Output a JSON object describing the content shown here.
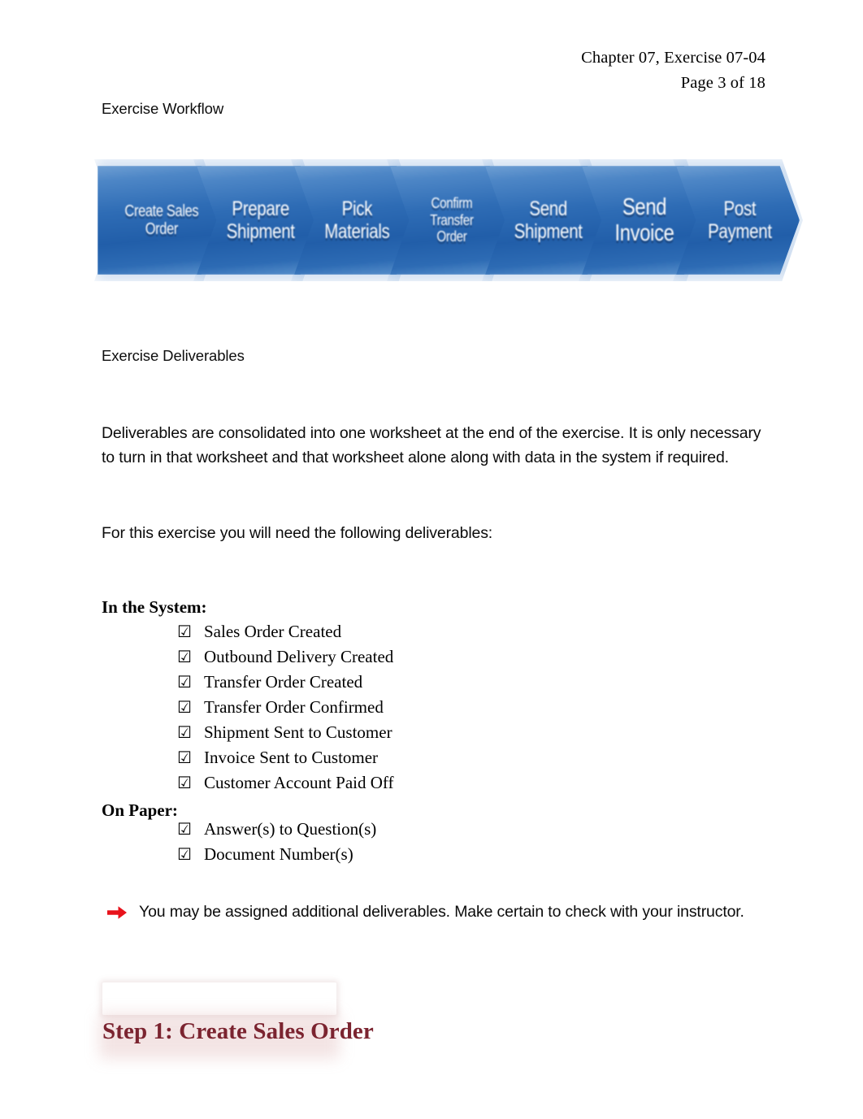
{
  "header": {
    "line1": "Chapter 07, Exercise 07-04",
    "line2": "Page 3 of 18"
  },
  "sections": {
    "workflow_heading": "Exercise Workflow",
    "deliverables_heading": "Exercise Deliverables"
  },
  "workflow": {
    "steps": [
      {
        "label": "Create Sales\nOrder",
        "size": "sz-small"
      },
      {
        "label": "Prepare\nShipment",
        "size": "sz-normal"
      },
      {
        "label": "Pick\nMaterials",
        "size": "sz-normal"
      },
      {
        "label": "Confirm\nTransfer\nOrder",
        "size": "sz-tiny"
      },
      {
        "label": "Send\nShipment",
        "size": "sz-normal"
      },
      {
        "label": "Send\nInvoice",
        "size": "sz-large"
      },
      {
        "label": "Post\nPayment",
        "size": "sz-normal"
      }
    ],
    "accent_color": "#215ea9",
    "glow_color": "#96b9e1"
  },
  "paragraphs": {
    "deliverables_intro": "Deliverables are consolidated into one worksheet at the end of the exercise. It is only necessary to turn in that worksheet and that worksheet alone along with data in the system if required.",
    "need_following": "For this exercise you will need the following deliverables:"
  },
  "deliverables": {
    "checkbox_glyph": "☑",
    "system": {
      "title": "In the System:",
      "items": [
        "Sales Order Created",
        "Outbound Delivery Created",
        "Transfer Order Created",
        "Transfer Order Confirmed",
        "Shipment Sent to Customer",
        "Invoice Sent to Customer",
        "Customer Account Paid Off"
      ]
    },
    "paper": {
      "title": "On Paper:",
      "items": [
        "Answer(s) to Question(s)",
        "Document Number(s)"
      ]
    }
  },
  "note": {
    "icon": "red-right-arrow-icon",
    "color": "#e8121b",
    "text": "You may be assigned additional deliverables. Make certain to check with your instructor."
  },
  "step": {
    "title": "Step 1: Create Sales Order",
    "color": "#7b2430"
  }
}
